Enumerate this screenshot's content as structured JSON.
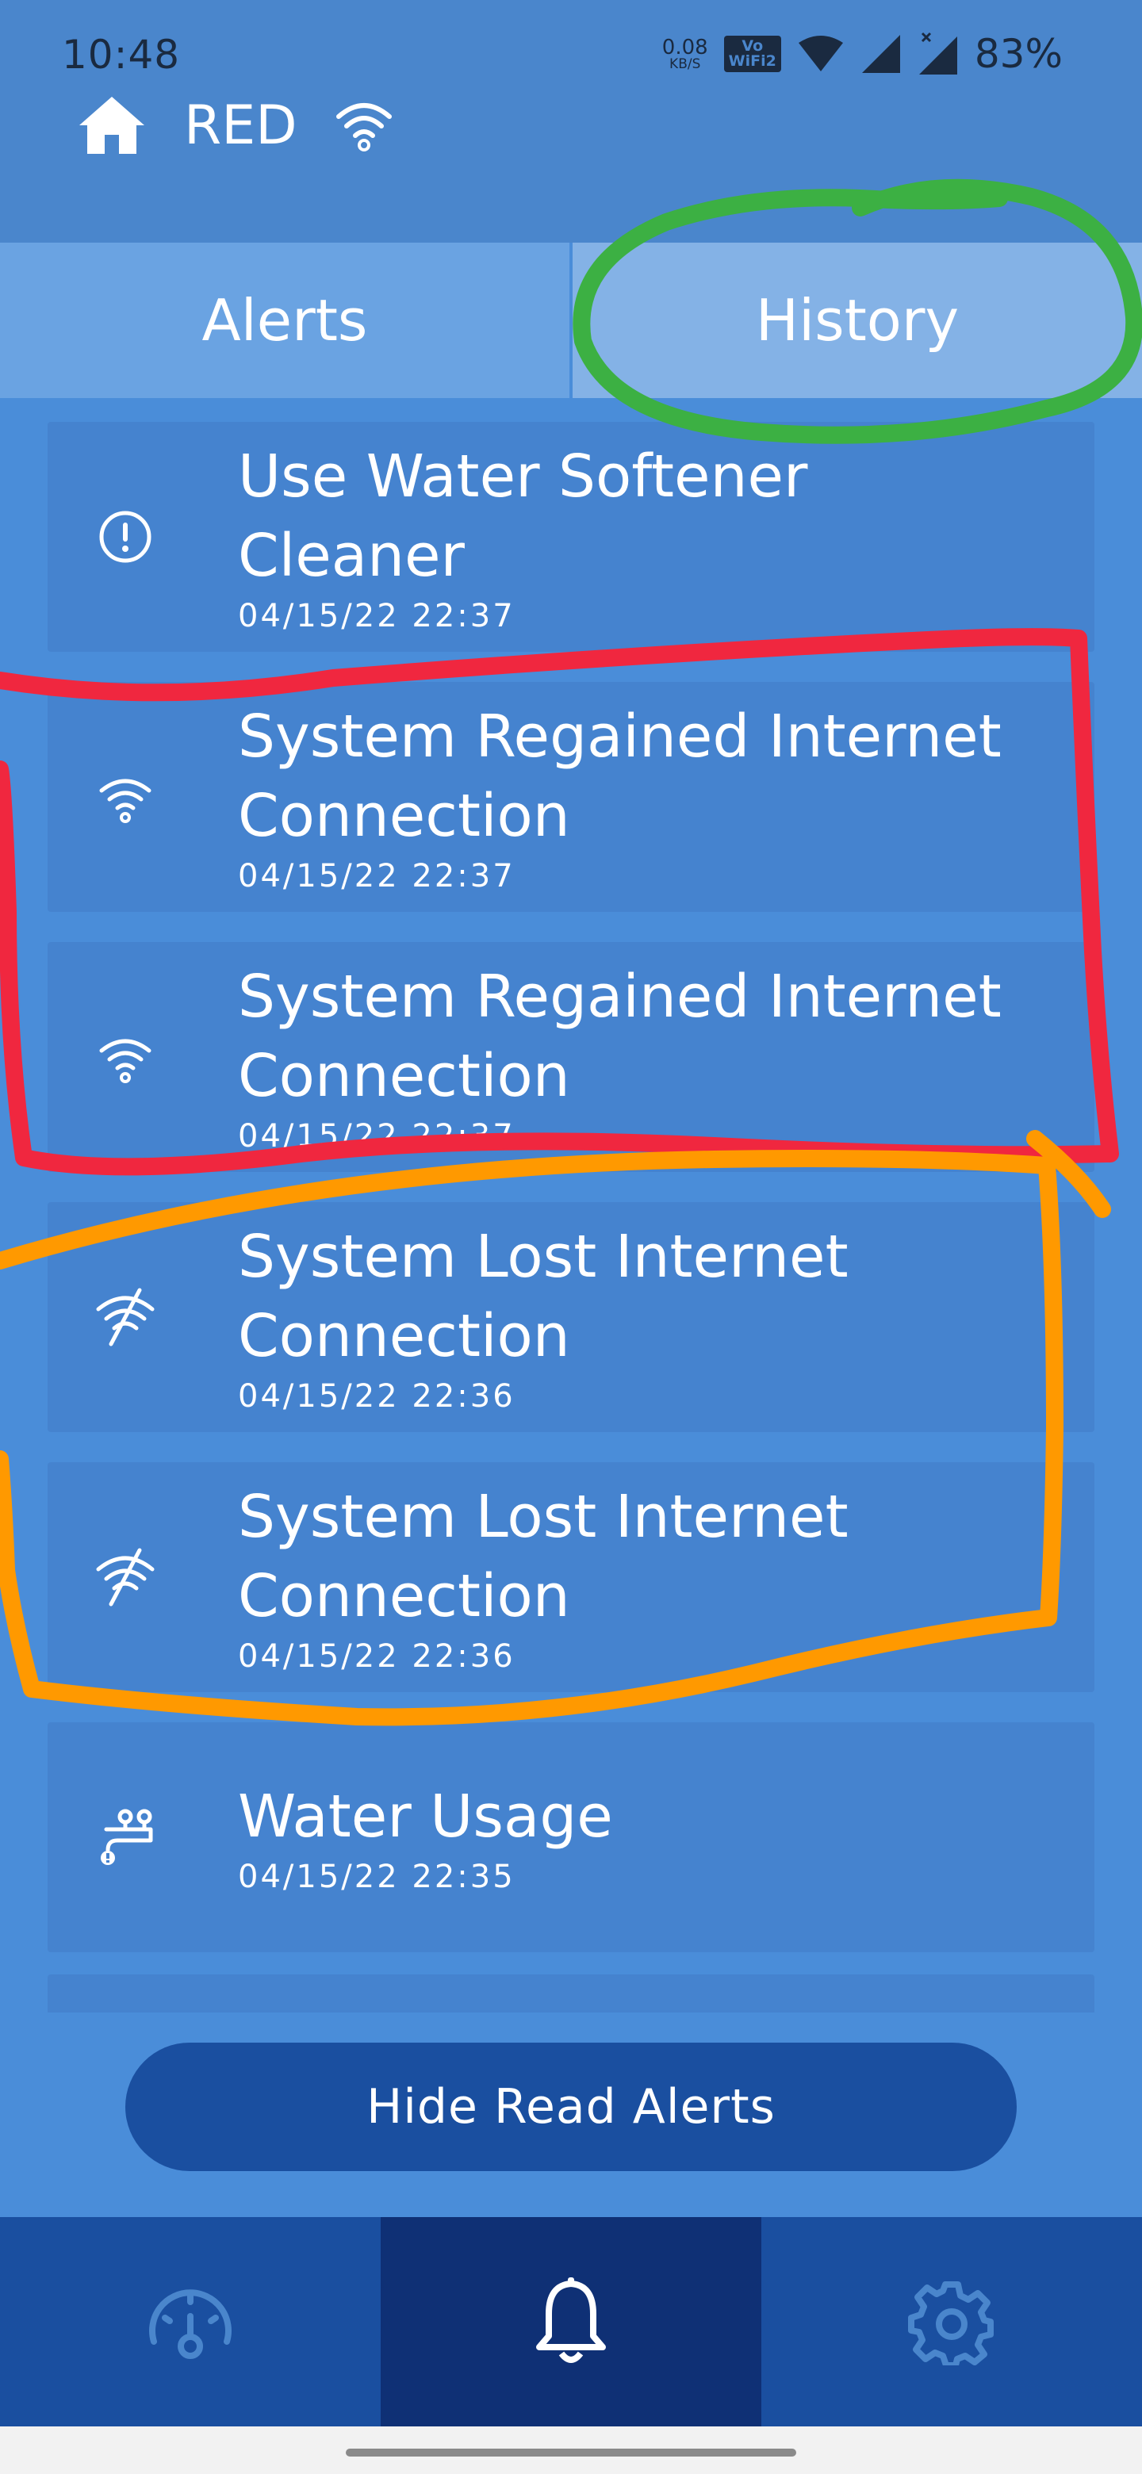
{
  "status_bar": {
    "time": "10:48",
    "net_speed_value": "0.08",
    "net_speed_unit": "KB/S",
    "volte_line1": "Vo",
    "volte_line2": "WiFi2",
    "battery": "83%"
  },
  "header": {
    "title": "RED"
  },
  "tabs": [
    {
      "label": "Alerts",
      "active": false
    },
    {
      "label": "History",
      "active": true
    }
  ],
  "alerts": [
    {
      "icon": "alert-circle-icon",
      "title_line1": "Use Water Softener",
      "title_line2": "Cleaner",
      "date": "04/15/22 22:37"
    },
    {
      "icon": "wifi-icon",
      "title_line1": "System Regained Internet",
      "title_line2": "Connection",
      "date": "04/15/22 22:37"
    },
    {
      "icon": "wifi-icon",
      "title_line1": "System Regained Internet",
      "title_line2": "Connection",
      "date": "04/15/22 22:37"
    },
    {
      "icon": "wifi-off-icon",
      "title_line1": "System Lost Internet",
      "title_line2": "Connection",
      "date": "04/15/22 22:36"
    },
    {
      "icon": "wifi-off-icon",
      "title_line1": "System Lost Internet",
      "title_line2": "Connection",
      "date": "04/15/22 22:36"
    },
    {
      "icon": "faucet-icon",
      "title_line1": "Water Usage",
      "title_line2": "",
      "date": "04/15/22 22:35"
    }
  ],
  "hide_read_button": "Hide Read Alerts",
  "bottom_nav": [
    {
      "icon": "gauge-icon",
      "active": false
    },
    {
      "icon": "bell-icon",
      "active": true
    },
    {
      "icon": "gear-icon",
      "active": false
    }
  ],
  "colors": {
    "background": "#4a8dd9",
    "header": "#4a86cc",
    "card": "#4583cf",
    "button": "#1a4fa0",
    "nav_active": "#0f3075",
    "annotation_green": "#3cb043",
    "annotation_red": "#f0273f",
    "annotation_orange": "#ff9900"
  }
}
